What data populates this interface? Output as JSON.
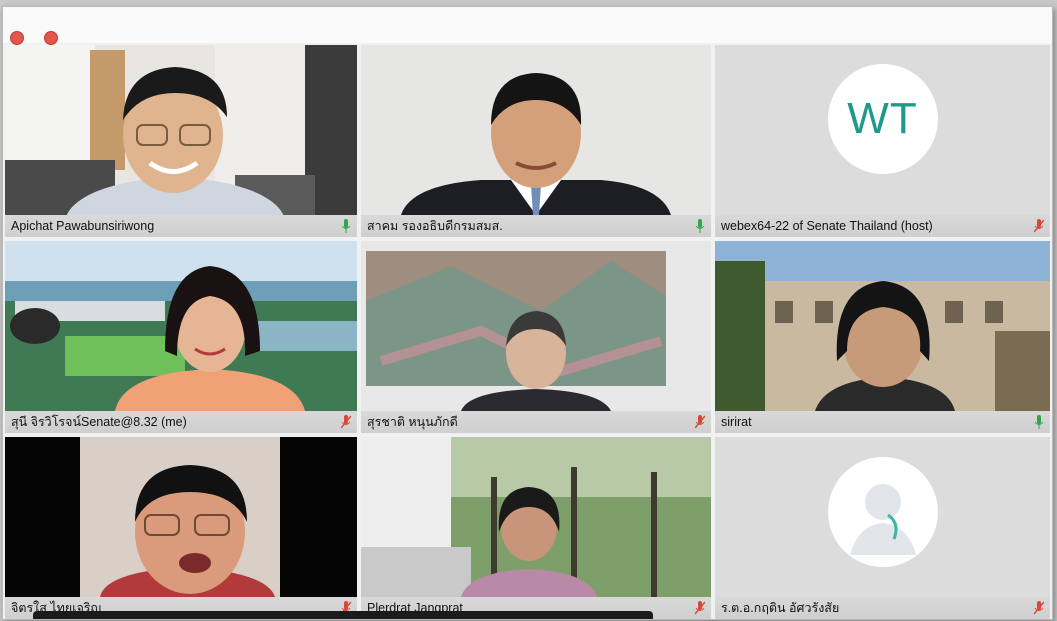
{
  "participants": [
    {
      "name": "Apichat Pawabunsiriwong",
      "mic": "on"
    },
    {
      "name": "สาคม รองอธิบดีกรมสมส.",
      "mic": "on"
    },
    {
      "name": "webex64-22 of  Senate Thailand (host)",
      "mic": "muted",
      "initials": "WT"
    },
    {
      "name": "สุนี จิรวิโรจน์Senate@8.32 (me)",
      "mic": "muted"
    },
    {
      "name": "สุรชาติ หนุนภักดี",
      "mic": "muted"
    },
    {
      "name": "sirirat",
      "mic": "on"
    },
    {
      "name": "จิตรใส ไทยเจริญ",
      "mic": "muted"
    },
    {
      "name": "Plerdrat Jangprat",
      "mic": "muted"
    },
    {
      "name": "ร.ต.อ.กฤติน อัศวรังสัย",
      "mic": "muted"
    }
  ],
  "colors": {
    "mic_on": "#2aa84a",
    "mic_muted": "#d9473b",
    "initials": "#1e9a8a"
  }
}
